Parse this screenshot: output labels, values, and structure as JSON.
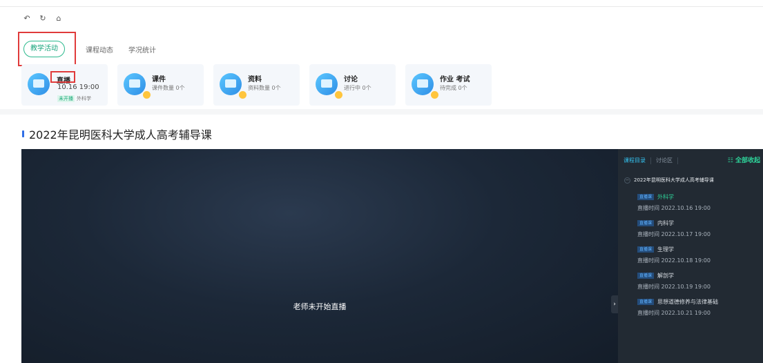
{
  "toolbar": {
    "undo_icon": "↶",
    "refresh_icon": "↻",
    "home_icon": "⌂"
  },
  "tabs": [
    {
      "label": "教学活动",
      "active": true
    },
    {
      "label": "课程动态",
      "active": false
    },
    {
      "label": "学况统计",
      "active": false
    }
  ],
  "cards": {
    "live": {
      "title": "直播",
      "time": "10.16 19:00",
      "tag": "未开播",
      "subject": "外科学"
    },
    "courseware": {
      "title": "课件",
      "sub": "课件数量 0个"
    },
    "materials": {
      "title": "资料",
      "sub": "资料数量 0个"
    },
    "discussion": {
      "title": "讨论",
      "sub": "进行中 0个"
    },
    "homework": {
      "title": "作业 考试",
      "sub": "待完成 0个"
    }
  },
  "course": {
    "title": "2022年昆明医科大学成人高考辅导课"
  },
  "player": {
    "message": "老师未开始直播"
  },
  "sidebar": {
    "tabs": [
      {
        "label": "课程目录",
        "active": true
      },
      {
        "label": "讨论区",
        "active": false
      }
    ],
    "collapse_all": "全部收起",
    "group_title": "2022年昆明医科大学成人高考辅导课",
    "lessons": [
      {
        "tag": "直播课",
        "name": "外科学",
        "time": "直播时间 2022.10.16 19:00",
        "current": true
      },
      {
        "tag": "直播课",
        "name": "内科学",
        "time": "直播时间 2022.10.17 19:00",
        "current": false
      },
      {
        "tag": "直播课",
        "name": "生理学",
        "time": "直播时间 2022.10.18 19:00",
        "current": false
      },
      {
        "tag": "直播课",
        "name": "解剖学",
        "time": "直播时间 2022.10.19 19:00",
        "current": false
      },
      {
        "tag": "直播课",
        "name": "思想道德修养与法律基础",
        "time": "直播时间 2022.10.21 19:00",
        "current": false
      }
    ]
  },
  "colors": {
    "accent_green": "#18a57c",
    "highlight_red": "#e03a3a",
    "sidebar_bg": "#222a33",
    "player_bg": "#1c2838"
  }
}
